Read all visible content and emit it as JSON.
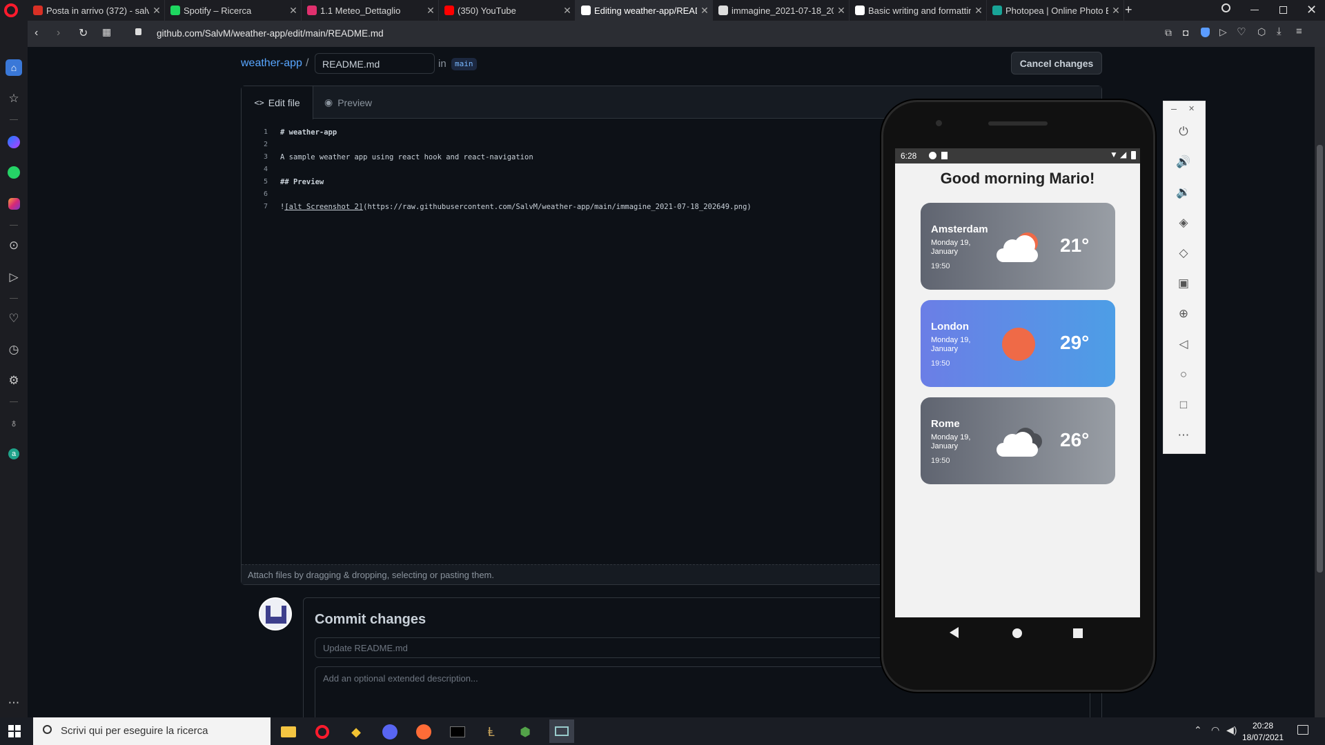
{
  "browser": {
    "tabs": [
      {
        "label": "Posta in arrivo (372) - salv",
        "color": "#d93025"
      },
      {
        "label": "Spotify – Ricerca",
        "color": "#1ed760"
      },
      {
        "label": "1.1 Meteo_Dettaglio",
        "color": "#e0306e"
      },
      {
        "label": "(350) YouTube",
        "color": "#ff0000"
      },
      {
        "label": "Editing weather-app/READ",
        "color": "#ffffff"
      },
      {
        "label": "immagine_2021-07-18_202",
        "color": "#dddddd"
      },
      {
        "label": "Basic writing and formattin",
        "color": "#ffffff"
      },
      {
        "label": "Photopea | Online Photo E",
        "color": "#18a497"
      }
    ],
    "url": "github.com/SalvM/weather-app/edit/main/README.md"
  },
  "github": {
    "repo": "weather-app",
    "sep": "/",
    "filename": "README.md",
    "in": "in",
    "branch": "main",
    "cancel": "Cancel changes",
    "tab_edit": "Edit file",
    "tab_preview": "Preview",
    "lines": [
      {
        "n": "1",
        "text": "# weather-app",
        "bold": true
      },
      {
        "n": "2",
        "text": ""
      },
      {
        "n": "3",
        "text": "A sample weather app using react hook and react-navigation"
      },
      {
        "n": "4",
        "text": ""
      },
      {
        "n": "5",
        "text": "## Preview",
        "bold": true
      },
      {
        "n": "6",
        "text": ""
      },
      {
        "n": "7",
        "prefix": "!",
        "link": "[alt Screenshot 2]",
        "text": "(https://raw.githubusercontent.com/SalvM/weather-app/main/immagine_2021-07-18_202649.png)"
      }
    ],
    "attach": "Attach files by dragging & dropping, selecting or pasting them.",
    "commit_title": "Commit changes",
    "commit_placeholder": "Update README.md",
    "desc_placeholder": "Add an optional extended description..."
  },
  "phone": {
    "clock": "6:28",
    "greeting": "Good morning Mario!",
    "cards": [
      {
        "city": "Amsterdam",
        "date": "Monday 19, January",
        "time": "19:50",
        "temp": "21°",
        "icon": "cloud-sun-icon"
      },
      {
        "city": "London",
        "date": "Monday 19, January",
        "time": "19:50",
        "temp": "29°",
        "icon": "sun-icon"
      },
      {
        "city": "Rome",
        "date": "Monday 19, January",
        "time": "19:50",
        "temp": "26°",
        "icon": "cloud-dark-icon"
      }
    ]
  },
  "taskbar": {
    "search": "Scrivi qui per eseguire la ricerca",
    "time": "20:28",
    "date": "18/07/2021"
  }
}
